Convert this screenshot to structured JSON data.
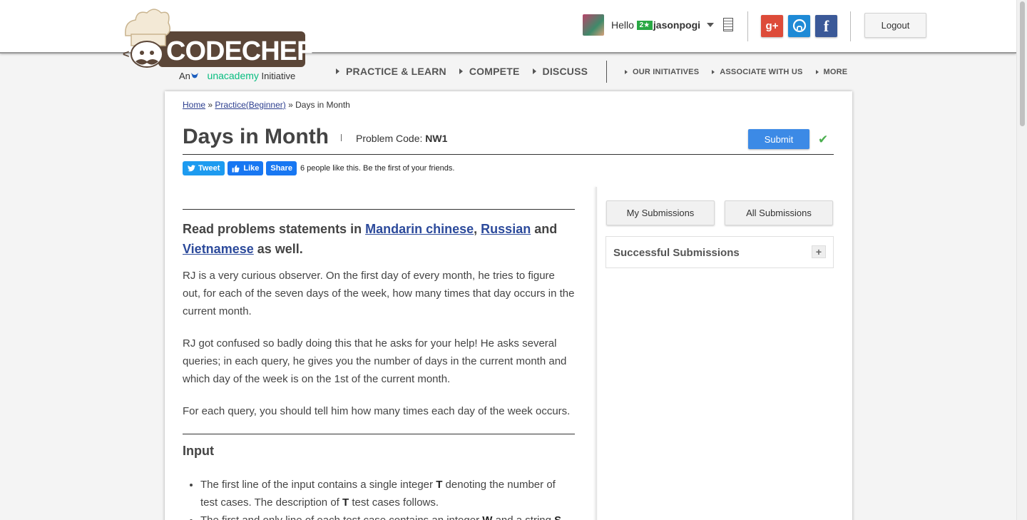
{
  "header": {
    "logo_text": "CODECHEF",
    "logo_sub_prefix": "An",
    "logo_sub_brand": "unacademy",
    "logo_sub_suffix": "Initiative",
    "hello": "Hello",
    "user_rating_badge": "2★",
    "username": "jasonpogi",
    "logout_label": "Logout",
    "social": {
      "gplus": "g+",
      "github": "◯",
      "facebook": "f"
    }
  },
  "nav": {
    "main": [
      "PRACTICE & LEARN",
      "COMPETE",
      "DISCUSS"
    ],
    "secondary": [
      "OUR INITIATIVES",
      "ASSOCIATE WITH US",
      "MORE"
    ]
  },
  "breadcrumb": {
    "home": "Home",
    "sep": "»",
    "practice": "Practice(Beginner)",
    "current": "Days in Month"
  },
  "problem": {
    "title": "Days in Month",
    "code_label": "Problem Code:",
    "code": "NW1",
    "submit_label": "Submit",
    "check": "✔"
  },
  "share": {
    "tweet": "Tweet",
    "like": "Like",
    "share": "Share",
    "like_text": "6 people like this. Be the first of your friends."
  },
  "statement": {
    "lang_prefix": "Read problems statements in",
    "lang1": "Mandarin chinese",
    "comma": ",",
    "lang2": "Russian",
    "and": "and",
    "lang3": "Vietnamese",
    "lang_suffix": "as well.",
    "p1": "RJ is a very curious observer. On the first day of every month, he tries to figure out, for each of the seven days of the week, how many times that day occurs in the current month.",
    "p2": "RJ got confused so badly doing this that he asks for your help! He asks several queries; in each query, he gives you the number of days in the current month and which day of the week is on the 1st of the current month.",
    "p3": "For each query, you should tell him how many times each day of the week occurs.",
    "input_title": "Input",
    "li1_a": "The first line of the input contains a single integer",
    "li1_b": "T",
    "li1_c": "denoting the number of test cases. The description of",
    "li1_d": "T",
    "li1_e": "test cases follows.",
    "li2_a": "The first and only line of each test case contains an integer",
    "li2_b": "W",
    "li2_c": "and a string",
    "li2_d": "S"
  },
  "sidebar": {
    "my_submissions": "My Submissions",
    "all_submissions": "All Submissions",
    "successful_submissions": "Successful Submissions",
    "expand": "+"
  }
}
